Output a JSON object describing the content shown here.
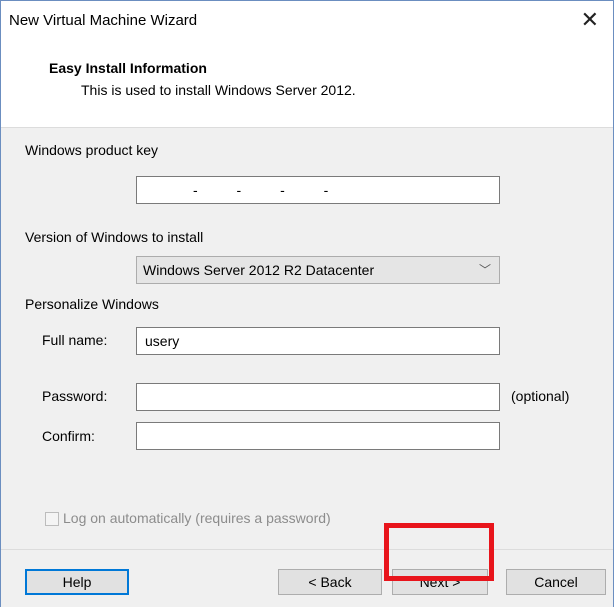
{
  "window": {
    "title": "New Virtual Machine Wizard",
    "close_symbol": "✕"
  },
  "header": {
    "title": "Easy Install Information",
    "subtitle": "This is used to install Windows Server 2012."
  },
  "product_key": {
    "label": "Windows product key",
    "value": "-          -          -          -"
  },
  "version": {
    "label": "Version of Windows to install",
    "selected": "Windows Server 2012 R2 Datacenter"
  },
  "personalize": {
    "label": "Personalize Windows",
    "full_name_label": "Full name:",
    "full_name_value": "usery",
    "password_label": "Password:",
    "password_value": "",
    "optional_label": "(optional)",
    "confirm_label": "Confirm:",
    "confirm_value": ""
  },
  "autologon": {
    "label": "Log on automatically (requires a password)",
    "checked": false,
    "enabled": false
  },
  "buttons": {
    "help": "Help",
    "back": "< Back",
    "next": "Next >",
    "cancel": "Cancel"
  },
  "colors": {
    "highlight": "#e8141b",
    "default_button_border": "#0078d7",
    "panel_bg": "#f0f0f0"
  }
}
